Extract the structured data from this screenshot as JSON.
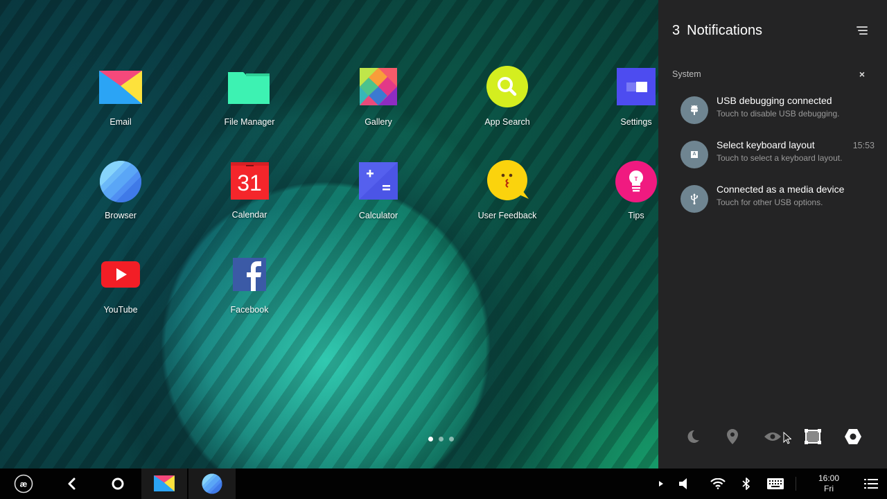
{
  "desktop": {
    "apps": [
      {
        "id": "email",
        "label": "Email"
      },
      {
        "id": "file-manager",
        "label": "File Manager"
      },
      {
        "id": "gallery",
        "label": "Gallery"
      },
      {
        "id": "app-search",
        "label": "App Search"
      },
      {
        "id": "settings",
        "label": "Settings"
      },
      {
        "id": "browser",
        "label": "Browser"
      },
      {
        "id": "calendar",
        "label": "Calendar",
        "icon_text": "31"
      },
      {
        "id": "calculator",
        "label": "Calculator"
      },
      {
        "id": "user-feedback",
        "label": "User Feedback"
      },
      {
        "id": "tips",
        "label": "Tips"
      },
      {
        "id": "youtube",
        "label": "YouTube"
      },
      {
        "id": "facebook",
        "label": "Facebook"
      }
    ],
    "pages": {
      "count": 3,
      "current": 1
    }
  },
  "notifications": {
    "count": "3",
    "title": "Notifications",
    "group_label": "System",
    "group_close": "×",
    "items": [
      {
        "icon": "android-bug-icon",
        "title": "USB debugging connected",
        "subtitle": "Touch to disable USB debugging.",
        "time": ""
      },
      {
        "icon": "keyboard-icon",
        "title": "Select keyboard layout",
        "subtitle": "Touch to select a keyboard layout.",
        "time": "15:53",
        "icon_text": "A"
      },
      {
        "icon": "usb-icon",
        "title": "Connected as a media device",
        "subtitle": "Touch for other USB options.",
        "time": ""
      }
    ],
    "quick_settings": [
      {
        "id": "night-mode",
        "icon": "moon-icon",
        "active": false
      },
      {
        "id": "location",
        "icon": "location-pin-icon",
        "active": false
      },
      {
        "id": "eye-protection",
        "icon": "eye-icon",
        "active": false
      },
      {
        "id": "screenshot",
        "icon": "screenshot-icon",
        "active": true
      },
      {
        "id": "settings",
        "icon": "hex-settings-icon",
        "active": true
      }
    ]
  },
  "taskbar": {
    "start_icon": "remix-logo-icon",
    "running_apps": [
      "Email",
      "Browser"
    ],
    "clock": {
      "time": "16:00",
      "day": "Fri"
    }
  },
  "colors": {
    "panel_bg": "#242425",
    "notif_icon_bg": "#6f8591",
    "taskbar_bg": "#020202"
  }
}
